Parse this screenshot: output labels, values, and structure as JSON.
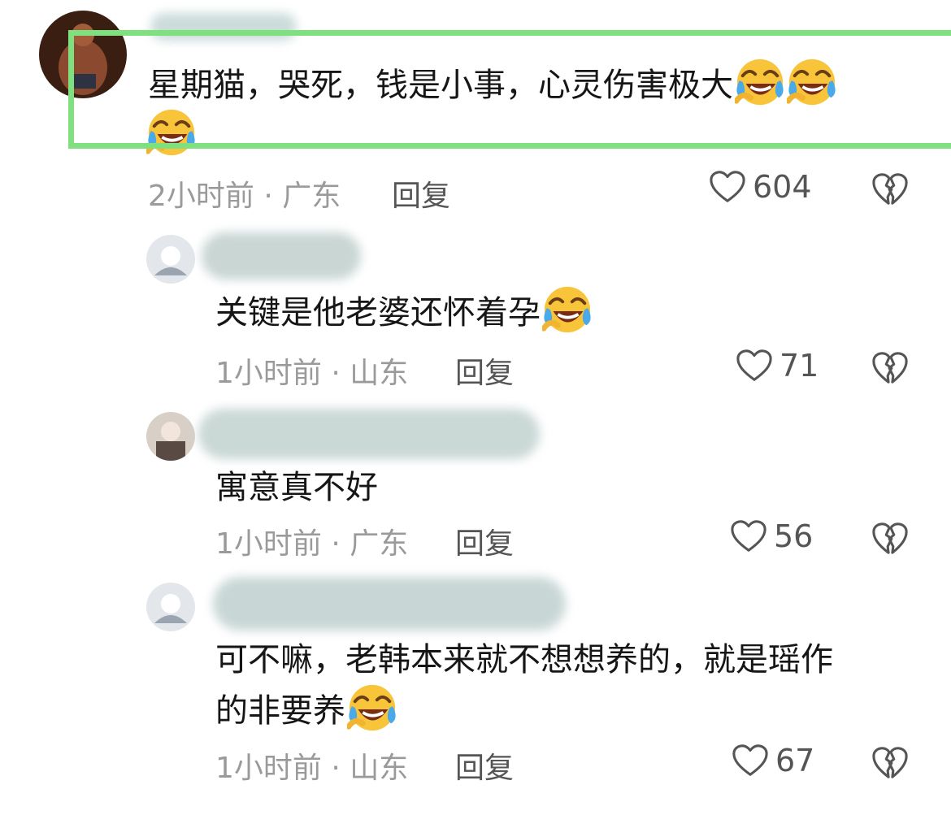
{
  "comments": [
    {
      "text_lines": [
        "星期猫，哭死，钱是小事，心灵伤害极大",
        ""
      ],
      "emojis": [
        "grinning-squint-tears-emoji",
        "grinning-squint-tears-emoji",
        "grinning-squint-tears-emoji"
      ],
      "meta": "2小时前 · 广东",
      "reply": "回复",
      "likes": "604"
    },
    {
      "text_lines": [
        "关键是他老婆还怀着孕"
      ],
      "emojis": [
        "grinning-squint-tears-emoji"
      ],
      "meta": "1小时前 · 山东",
      "reply": "回复",
      "likes": "71"
    },
    {
      "text_lines": [
        "寓意真不好"
      ],
      "meta": "1小时前 · 广东",
      "reply": "回复",
      "likes": "56"
    },
    {
      "text_lines": [
        "可不嘛，老韩本来就不想想养的，就是瑶作",
        "的非要养"
      ],
      "emojis": [
        "grinning-squint-tears-emoji"
      ],
      "meta": "1小时前 · 山东",
      "reply": "回复",
      "likes": "67"
    }
  ],
  "colors": {
    "highlight": "#7fe07f",
    "meta_text": "#9a9a9a",
    "reply_text": "#555555",
    "blur_name": "#c9d6d4"
  },
  "icons": [
    "heart-outline-icon",
    "broken-heart-icon"
  ]
}
